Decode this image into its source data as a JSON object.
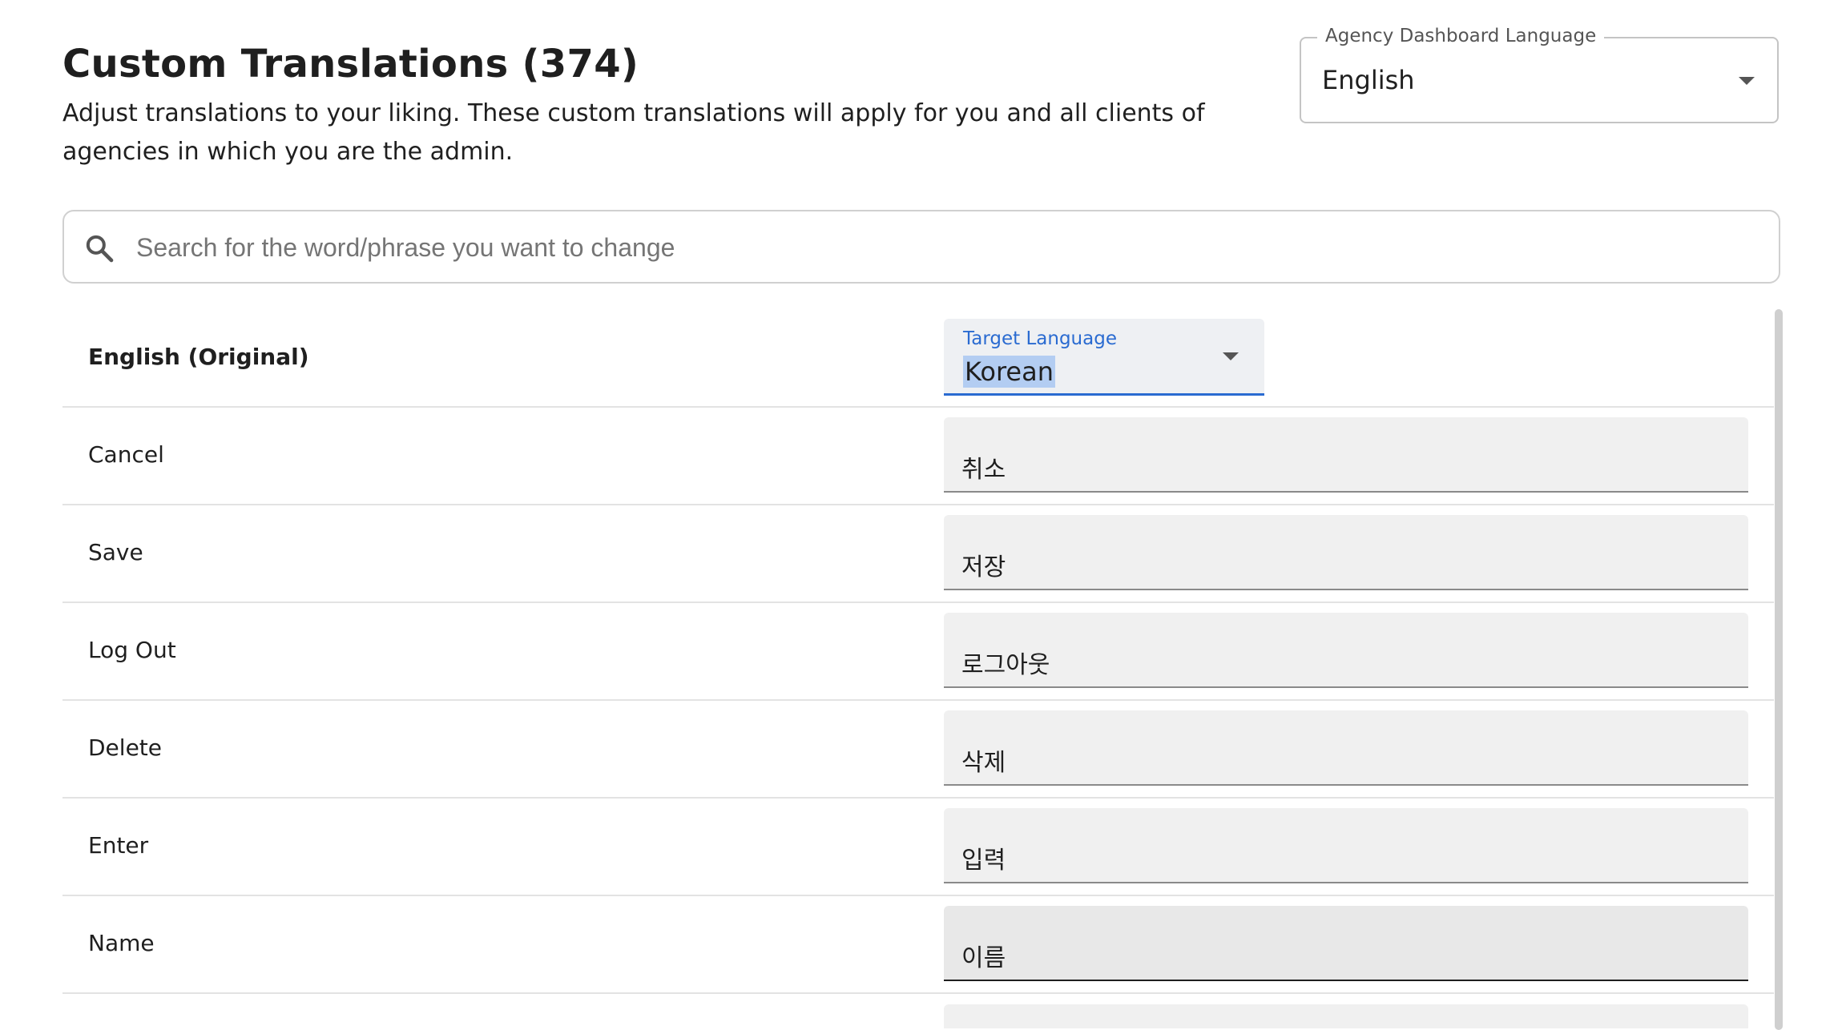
{
  "header": {
    "title": "Custom Translations (374)",
    "subtitle": "Adjust translations to your liking. These custom translations will apply for you and all clients of agencies in which you are the admin."
  },
  "dashboard_language": {
    "label": "Agency Dashboard Language",
    "value": "English"
  },
  "search": {
    "placeholder": "Search for the word/phrase you want to change",
    "value": ""
  },
  "table": {
    "original_header": "English (Original)",
    "target_language_label": "Target Language",
    "target_language_value": "Korean",
    "rows": [
      {
        "original": "Cancel",
        "translation": "취소"
      },
      {
        "original": "Save",
        "translation": "저장"
      },
      {
        "original": "Log Out",
        "translation": "로그아웃"
      },
      {
        "original": "Delete",
        "translation": "삭제"
      },
      {
        "original": "Enter",
        "translation": "입력"
      },
      {
        "original": "Name",
        "translation": "이름"
      }
    ]
  },
  "colors": {
    "accent": "#2a6bd1",
    "text": "#1f1f1f",
    "field_bg": "#f0f0f0",
    "selection": "#b3cdf2"
  }
}
